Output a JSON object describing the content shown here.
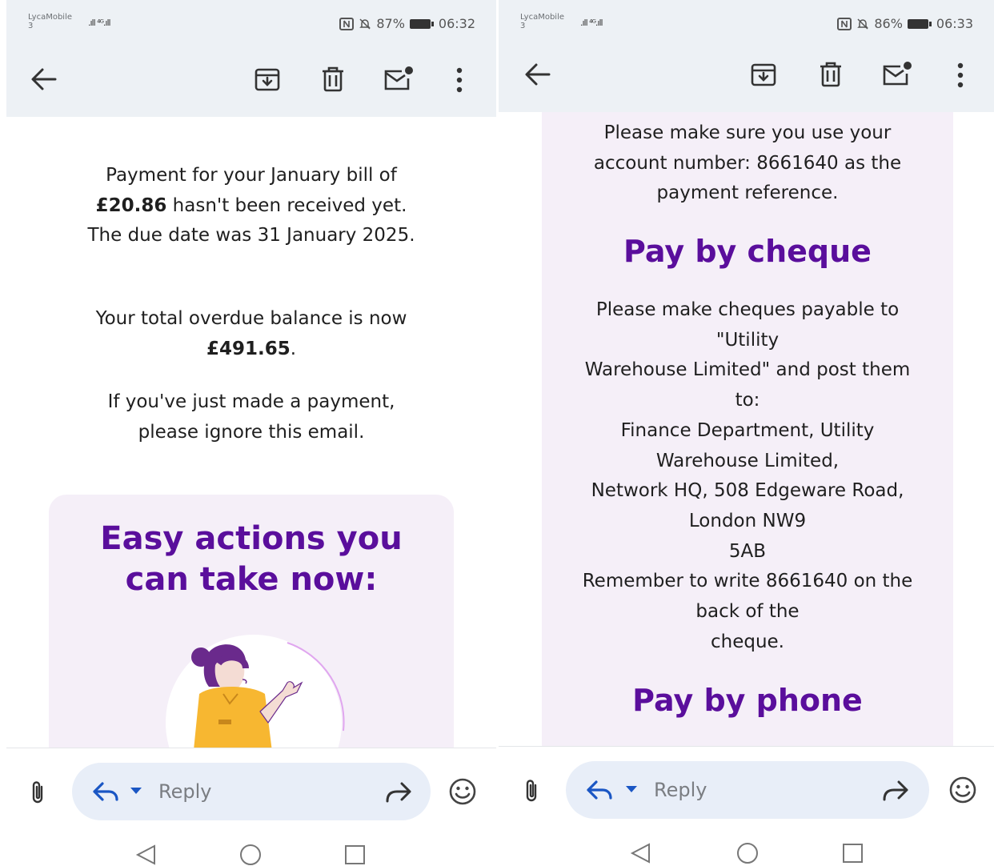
{
  "left": {
    "status": {
      "carrier": "LycaMobile",
      "carrier_sub": "3",
      "signal": ".ıll ⁴ᴳ.ıll",
      "battery": "87%",
      "time": "06:32"
    },
    "body": {
      "bill_pre": "Payment for your January bill of ",
      "bill_amount": "£20.86",
      "bill_post": " hasn't been received yet. The due date was 31 January 2025.",
      "overdue_pre": "Your total overdue balance is now ",
      "overdue_amount": "£491.65",
      "overdue_post": ".",
      "ignore": "If you've just made a payment, please ignore this email.",
      "card_heading": "Easy actions you can take now:"
    },
    "reply": {
      "placeholder": "Reply"
    }
  },
  "right": {
    "status": {
      "carrier": "LycaMobile",
      "carrier_sub": "3",
      "signal": ".ıll ⁴ᴳ.ıll",
      "battery": "86%",
      "time": "06:33"
    },
    "body": {
      "reference_text": "Please make sure you use your account number: 8661640 as the payment reference.",
      "cheque_heading": "Pay by cheque",
      "cheque_lines": [
        "Please make cheques payable to",
        "\"Utility",
        "Warehouse Limited\" and post them",
        "to:",
        "Finance Department, Utility",
        "Warehouse Limited,",
        "Network HQ, 508 Edgeware Road,",
        "London NW9",
        "5AB",
        "Remember to write 8661640 on the",
        "back of the",
        "cheque."
      ],
      "phone_heading": "Pay by phone"
    },
    "reply": {
      "placeholder": "Reply"
    }
  },
  "colors": {
    "heading_purple": "#5a0e9c",
    "card_background": "#f5eff8",
    "appbar_background": "#edf1f5",
    "reply_pill": "#e8eef8",
    "reply_icon_blue": "#1a56c4"
  },
  "icons": [
    "back-arrow-icon",
    "archive-icon",
    "delete-icon",
    "mark-unread-icon",
    "more-vert-icon",
    "attach-icon",
    "reply-icon",
    "dropdown-arrow-icon",
    "forward-icon",
    "emoji-icon",
    "nav-back-icon",
    "nav-home-icon",
    "nav-recents-icon"
  ]
}
